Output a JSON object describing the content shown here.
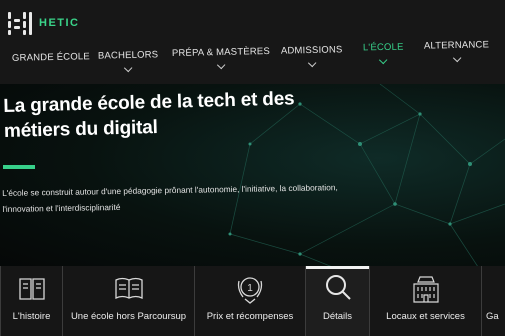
{
  "brand": {
    "name": "HETIC",
    "accent_color": "#37d08a"
  },
  "nav": {
    "items": [
      {
        "label": "GRANDE ÉCOLE",
        "has_dropdown": false,
        "active": false
      },
      {
        "label": "BACHELORS",
        "has_dropdown": true,
        "active": false
      },
      {
        "label": "PRÉPA & MASTÈRES",
        "has_dropdown": true,
        "active": false
      },
      {
        "label": "ADMISSIONS",
        "has_dropdown": true,
        "active": false
      },
      {
        "label": "L'ÉCOLE",
        "has_dropdown": true,
        "active": true
      },
      {
        "label": "ALTERNANCE",
        "has_dropdown": true,
        "active": false
      }
    ]
  },
  "hero": {
    "title_line1": "La grande école de la tech et des",
    "title_line2": "métiers du digital",
    "description_line1": "L'école se construit autour d'une pédagogie prônant l'autonomie, l'initiative, la collaboration,",
    "description_line2": "l'innovation et l'interdisciplinarité"
  },
  "tabs": [
    {
      "label": "L'histoire",
      "icon": "book-icon",
      "active": false
    },
    {
      "label": "Une école hors Parcoursup",
      "icon": "open-book-icon",
      "active": false
    },
    {
      "label": "Prix et récompenses",
      "icon": "award-medal-icon",
      "active": false
    },
    {
      "label": "Détails",
      "icon": "magnifier-icon",
      "active": true
    },
    {
      "label": "Locaux et services",
      "icon": "building-icon",
      "active": false
    },
    {
      "label": "Ga",
      "icon": "tab-icon",
      "active": false
    }
  ]
}
